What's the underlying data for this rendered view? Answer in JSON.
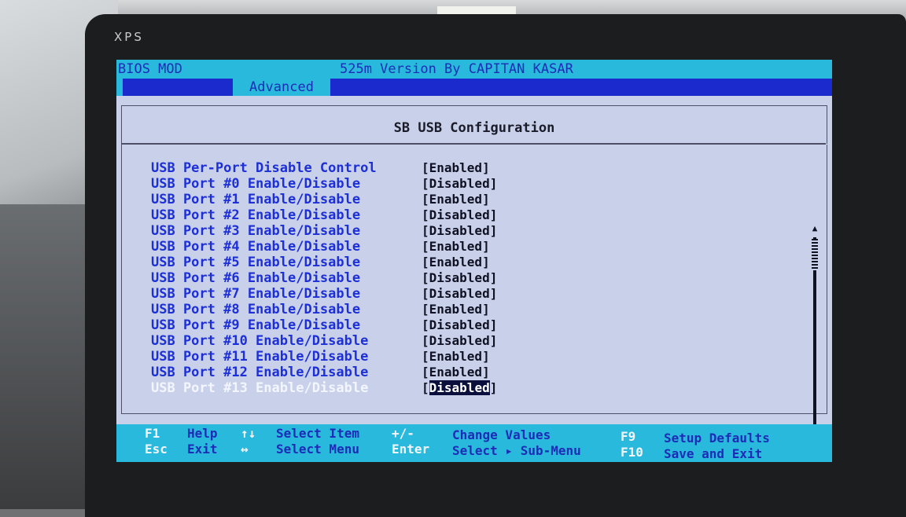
{
  "device": {
    "brand": "XPS"
  },
  "header": {
    "bios_mod": "BIOS MOD",
    "version": "525m Version By CAPITAN KASAR",
    "active_tab": "Advanced"
  },
  "page_title": "SB USB Configuration",
  "settings": [
    {
      "label": "USB Per-Port Disable Control",
      "value": "[Enabled]"
    },
    {
      "label": "USB Port #0 Enable/Disable",
      "value": "[Disabled]"
    },
    {
      "label": "USB Port #1 Enable/Disable",
      "value": "[Enabled]"
    },
    {
      "label": "USB Port #2 Enable/Disable",
      "value": "[Disabled]"
    },
    {
      "label": "USB Port #3 Enable/Disable",
      "value": "[Disabled]"
    },
    {
      "label": "USB Port #4 Enable/Disable",
      "value": "[Enabled]"
    },
    {
      "label": "USB Port #5 Enable/Disable",
      "value": "[Enabled]"
    },
    {
      "label": "USB Port #6 Enable/Disable",
      "value": "[Disabled]"
    },
    {
      "label": "USB Port #7 Enable/Disable",
      "value": "[Disabled]"
    },
    {
      "label": "USB Port #8 Enable/Disable",
      "value": "[Enabled]"
    },
    {
      "label": "USB Port #9 Enable/Disable",
      "value": "[Disabled]"
    },
    {
      "label": "USB Port #10 Enable/Disable",
      "value": "[Disabled]"
    },
    {
      "label": "USB Port #11 Enable/Disable",
      "value": "[Enabled]"
    },
    {
      "label": "USB Port #12 Enable/Disable",
      "value": "[Enabled]"
    },
    {
      "label": "USB Port #13 Enable/Disable",
      "value": "Disabled",
      "selected": true
    }
  ],
  "selected_value_brackets": {
    "open": "[",
    "close": "]"
  },
  "help": {
    "f1_key": "F1",
    "f1_desc": "Help",
    "esc_key": "Esc",
    "esc_desc": "Exit",
    "updown_key": "↑↓",
    "updown_desc": "Select Item",
    "leftright_key": "↔",
    "leftright_desc": "Select Menu",
    "plusminus_key": "+/-",
    "plusminus_desc": "Change Values",
    "enter_key": "Enter",
    "enter_desc": "Select ▸ Sub-Menu",
    "f9_key": "F9",
    "f9_desc": "Setup Defaults",
    "f10_key": "F10",
    "f10_desc": "Save and Exit"
  },
  "colors": {
    "bios_cyan": "#29b9dc",
    "bios_blue": "#1a2acd",
    "panel_bg": "#c9d1ea",
    "label_blue": "#1d2fd6",
    "highlight": "#0b0f3c"
  }
}
